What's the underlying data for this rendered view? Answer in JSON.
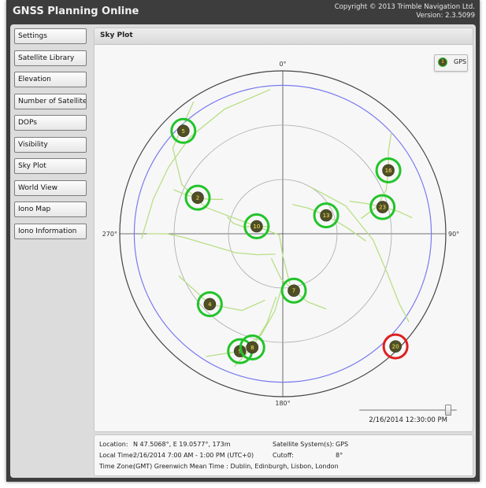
{
  "app": {
    "title": "GNSS Planning Online",
    "copyright": "Copyright ©  2013 Trimble Navigation Ltd.",
    "version": "Version: 2.3.5099"
  },
  "sidebar": {
    "items": [
      {
        "label": "Settings"
      },
      {
        "label": "Satellite Library"
      },
      {
        "label": "Elevation"
      },
      {
        "label": "Number of Satellites"
      },
      {
        "label": "DOPs"
      },
      {
        "label": "Visibility"
      },
      {
        "label": "Sky Plot"
      },
      {
        "label": "World View"
      },
      {
        "label": "Iono Map"
      },
      {
        "label": "Iono Information"
      }
    ]
  },
  "panel": {
    "title": "Sky Plot"
  },
  "legend": {
    "label": "GPS",
    "icon_label": "1"
  },
  "skyplot": {
    "labels": {
      "north": "0°",
      "east": "90°",
      "south": "180°",
      "west": "270°"
    },
    "cutoff_elevation_deg": 8,
    "colors": {
      "visible": "#22c42a",
      "below_cutoff": "#dd1f1f",
      "track": "#b8df86",
      "cutoff_ring": "#7a7af0",
      "horizon": "#444444",
      "grid": "#aaaaaa",
      "sat_fill": "#4f4f27",
      "sat_text": "#ffe45c"
    },
    "satellites": [
      {
        "prn": "5",
        "azimuth": 316,
        "elevation": 11,
        "status": "visible"
      },
      {
        "prn": "2",
        "azimuth": 293,
        "elevation": 39,
        "status": "visible"
      },
      {
        "prn": "10",
        "azimuth": 286,
        "elevation": 75,
        "status": "visible"
      },
      {
        "prn": "13",
        "azimuth": 67,
        "elevation": 64,
        "status": "visible"
      },
      {
        "prn": "23",
        "azimuth": 75,
        "elevation": 33,
        "status": "visible"
      },
      {
        "prn": "16",
        "azimuth": 59,
        "elevation": 22,
        "status": "visible"
      },
      {
        "prn": "7",
        "azimuth": 169,
        "elevation": 58,
        "status": "visible"
      },
      {
        "prn": "4",
        "azimuth": 226,
        "elevation": 34,
        "status": "visible"
      },
      {
        "prn": "9",
        "azimuth": 200,
        "elevation": 21,
        "status": "visible"
      },
      {
        "prn": "8",
        "azimuth": 195,
        "elevation": 25,
        "status": "visible"
      },
      {
        "prn": "20",
        "azimuth": 135,
        "elevation": 2,
        "status": "below_cutoff"
      }
    ],
    "tracks": [
      [
        [
          10,
          355
        ],
        [
          14,
          335
        ],
        [
          16,
          316
        ],
        [
          17,
          300
        ],
        [
          16,
          285
        ],
        [
          12,
          268
        ]
      ],
      [
        [
          2,
          326
        ],
        [
          13,
          308
        ],
        [
          28,
          296
        ],
        [
          45,
          289
        ],
        [
          60,
          288
        ],
        [
          75,
          286
        ],
        [
          88,
          250
        ],
        [
          78,
          180
        ],
        [
          62,
          172
        ]
      ],
      [
        [
          25,
          292
        ],
        [
          33,
          292
        ],
        [
          39,
          293
        ],
        [
          45,
          295
        ],
        [
          52,
          300
        ]
      ],
      [
        [
          15,
          270
        ],
        [
          26,
          270
        ],
        [
          35,
          268
        ],
        [
          48,
          262
        ],
        [
          62,
          248
        ],
        [
          72,
          230
        ],
        [
          78,
          200
        ]
      ],
      [
        [
          58,
          287
        ],
        [
          62,
          282
        ],
        [
          68,
          280
        ],
        [
          75,
          286
        ],
        [
          82,
          300
        ]
      ],
      [
        [
          44,
          95
        ],
        [
          54,
          85
        ],
        [
          64,
          67
        ],
        [
          70,
          45
        ],
        [
          73,
          18
        ]
      ],
      [
        [
          18,
          83
        ],
        [
          25,
          79
        ],
        [
          33,
          75
        ],
        [
          41,
          70
        ],
        [
          49,
          64
        ]
      ],
      [
        [
          8,
          47
        ],
        [
          16,
          52
        ],
        [
          22,
          59
        ],
        [
          28,
          67
        ],
        [
          36,
          74
        ],
        [
          46,
          79
        ]
      ],
      [
        [
          5,
          125
        ],
        [
          15,
          121
        ],
        [
          28,
          111
        ],
        [
          40,
          94
        ],
        [
          52,
          66
        ],
        [
          60,
          30
        ]
      ],
      [
        [
          42,
          150
        ],
        [
          50,
          160
        ],
        [
          58,
          169
        ],
        [
          65,
          182
        ],
        [
          75,
          205
        ]
      ],
      [
        [
          28,
          248
        ],
        [
          34,
          226
        ],
        [
          42,
          208
        ],
        [
          52,
          195
        ]
      ],
      [
        [
          10,
          212
        ],
        [
          21,
          200
        ],
        [
          33,
          192
        ],
        [
          47,
          186
        ],
        [
          62,
          180
        ]
      ],
      [
        [
          12,
          200
        ],
        [
          25,
          195
        ],
        [
          40,
          190
        ],
        [
          55,
          186
        ]
      ]
    ],
    "time_label": "2/16/2014 12:30:00 PM",
    "time_position": 0.9
  },
  "info": {
    "location_label": "Location:",
    "location_value": "N 47.5068°, E 19.0577°, 173m",
    "time_label": "Local Time:",
    "time_value": "2/16/2014 7:00 AM - 1:00 PM (UTC+0)",
    "timezone_label": "Time Zone:",
    "timezone_value": "(GMT) Greenwich Mean Time : Dublin, Edinburgh, Lisbon, London",
    "system_label": "Satellite System(s):",
    "system_value": "GPS",
    "cutoff_label": "Cutoff:",
    "cutoff_value": "8°"
  }
}
